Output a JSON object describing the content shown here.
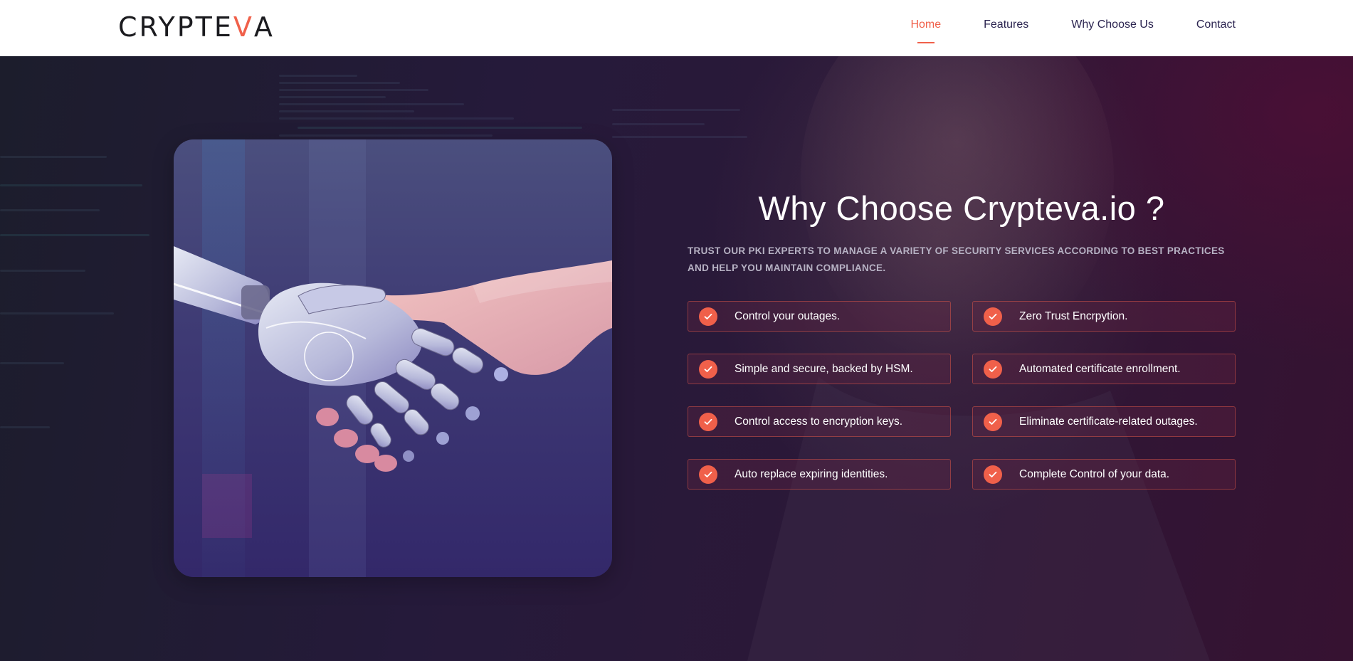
{
  "brand": {
    "logo_left": "CRYPTE",
    "logo_accent": "V",
    "logo_right": "A",
    "accent_color": "#f0604a"
  },
  "nav": {
    "items": [
      {
        "label": "Home",
        "active": true
      },
      {
        "label": "Features",
        "active": false
      },
      {
        "label": "Why Choose Us",
        "active": false
      },
      {
        "label": "Contact",
        "active": false
      }
    ]
  },
  "hero": {
    "title": "Why Choose Crypteva.io ?",
    "subtitle": "TRUST OUR PKI EXPERTS TO MANAGE A VARIETY OF SECURITY SERVICES ACCORDING TO BEST PRACTICES AND HELP YOU MAINTAIN COMPLIANCE.",
    "image_icon": "robot-human-handshake-image"
  },
  "features": {
    "icon": "check-icon",
    "items": [
      "Control your outages.",
      "Zero Trust Encrpytion.",
      "Simple and secure, backed by HSM.",
      "Automated certificate enrollment.",
      "Control access to encryption keys.",
      "Eliminate certificate-related outages.",
      "Auto replace expiring identities.",
      "Complete Control of your data."
    ]
  }
}
